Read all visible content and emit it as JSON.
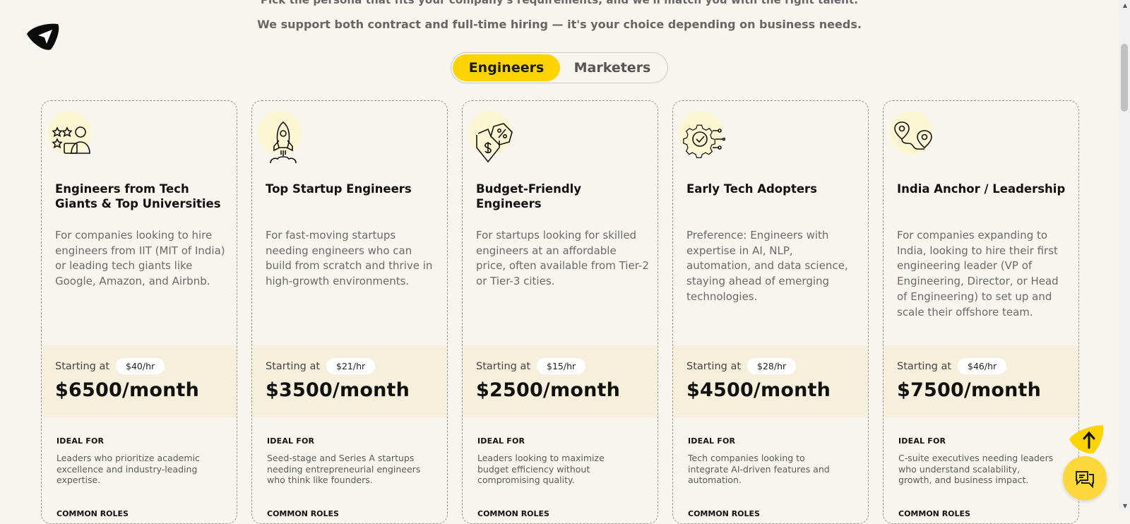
{
  "header": {
    "top_cut_text": "Pick the persona that fits your company's requirements, and we'll match you with the right talent.",
    "subtitle": "We support both contract and full-time hiring — it's your choice depending on business needs."
  },
  "toggle": {
    "engineers_label": "Engineers",
    "marketers_label": "Marketers",
    "active": "Engineers"
  },
  "labels": {
    "starting_at": "Starting at",
    "ideal_for": "IDEAL FOR",
    "common_roles": "COMMON ROLES"
  },
  "cards": [
    {
      "icon": "star-user-icon",
      "title": "Engineers from Tech Giants & Top Universities",
      "description": "For companies looking to hire engineers from IIT (MIT of India) or leading tech giants like Google, Amazon, and Airbnb.",
      "hourly": "$40/hr",
      "monthly": "$6500/month",
      "ideal_for": "Leaders who prioritize academic excellence and industry-leading expertise."
    },
    {
      "icon": "rocket-icon",
      "title": "Top Startup Engineers",
      "description": "For fast-moving startups needing engineers who can build from scratch and thrive in high-growth environments.",
      "hourly": "$21/hr",
      "monthly": "$3500/month",
      "ideal_for": "Seed-stage and Series A startups needing entrepreneurial engineers who think like founders."
    },
    {
      "icon": "budget-percent-icon",
      "title": "Budget-Friendly Engineers",
      "description": "For startups looking for skilled engineers at an affordable price, often available from Tier-2 or Tier-3 cities.",
      "hourly": "$15/hr",
      "monthly": "$2500/month",
      "ideal_for": "Leaders looking to maximize budget efficiency without compromising quality."
    },
    {
      "icon": "gear-check-icon",
      "title": "Early Tech Adopters",
      "description": "Preference: Engineers with expertise in AI, NLP, automation, and data science, staying ahead of emerging technologies.",
      "hourly": "$28/hr",
      "monthly": "$4500/month",
      "ideal_for": "Tech companies looking to integrate AI-driven features and automation."
    },
    {
      "icon": "location-route-icon",
      "title": "India Anchor / Leadership",
      "description": "For companies expanding to India, looking to hire their first engineering leader (VP of Engineering, Director, or Head of Engineering) to set up and scale their offshore team.",
      "hourly": "$46/hr",
      "monthly": "$7500/month",
      "ideal_for": "C-suite executives needing leaders who understand scalability, growth, and business impact."
    }
  ],
  "colors": {
    "background": "#f8f5ee",
    "accent": "#fdd400",
    "price_box": "#f5efdc"
  }
}
